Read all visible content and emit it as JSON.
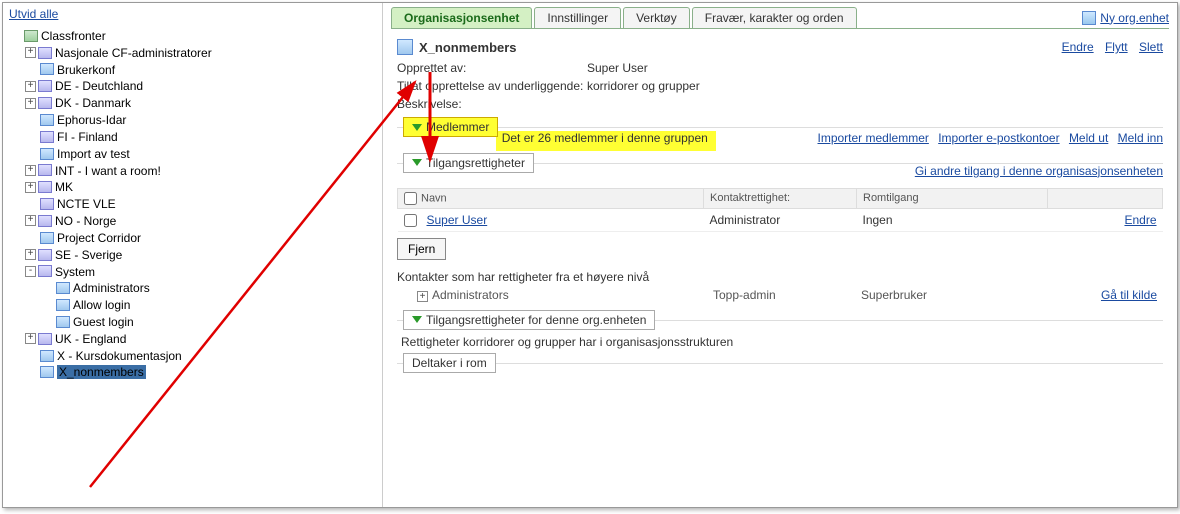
{
  "sidebar": {
    "expand_all": "Utvid alle",
    "items": [
      {
        "indent": 1,
        "toggle": "",
        "icon": "folder",
        "label": "Classfronter"
      },
      {
        "indent": 2,
        "toggle": "+",
        "icon": "grp",
        "label": "Nasjonale CF-administratorer"
      },
      {
        "indent": 2,
        "toggle": "",
        "icon": "usr",
        "label": "Brukerkonf"
      },
      {
        "indent": 2,
        "toggle": "+",
        "icon": "grp",
        "label": "DE - Deutchland"
      },
      {
        "indent": 2,
        "toggle": "+",
        "icon": "grp",
        "label": "DK - Danmark"
      },
      {
        "indent": 2,
        "toggle": "",
        "icon": "usr",
        "label": "Ephorus-Idar"
      },
      {
        "indent": 2,
        "toggle": "",
        "icon": "grp",
        "label": "FI - Finland"
      },
      {
        "indent": 2,
        "toggle": "",
        "icon": "usr",
        "label": "Import av test"
      },
      {
        "indent": 2,
        "toggle": "+",
        "icon": "grp",
        "label": "INT - I want a room!"
      },
      {
        "indent": 2,
        "toggle": "+",
        "icon": "grp",
        "label": "MK"
      },
      {
        "indent": 2,
        "toggle": "",
        "icon": "grp",
        "label": "NCTE VLE"
      },
      {
        "indent": 2,
        "toggle": "+",
        "icon": "grp",
        "label": "NO - Norge"
      },
      {
        "indent": 2,
        "toggle": "",
        "icon": "usr",
        "label": "Project Corridor"
      },
      {
        "indent": 2,
        "toggle": "+",
        "icon": "grp",
        "label": "SE - Sverige"
      },
      {
        "indent": 2,
        "toggle": "-",
        "icon": "grp",
        "label": "System"
      },
      {
        "indent": 3,
        "toggle": "",
        "icon": "usr",
        "label": "Administrators"
      },
      {
        "indent": 3,
        "toggle": "",
        "icon": "usr",
        "label": "Allow login"
      },
      {
        "indent": 3,
        "toggle": "",
        "icon": "usr",
        "label": "Guest login"
      },
      {
        "indent": 2,
        "toggle": "+",
        "icon": "grp",
        "label": "UK - England"
      },
      {
        "indent": 2,
        "toggle": "",
        "icon": "usr",
        "label": "X - Kursdokumentasjon"
      },
      {
        "indent": 2,
        "toggle": "",
        "icon": "usr",
        "label": "X_nonmembers",
        "selected": true
      }
    ]
  },
  "tabs": {
    "items": [
      {
        "label": "Organisasjonsenhet",
        "active": true
      },
      {
        "label": "Innstillinger"
      },
      {
        "label": "Verktøy"
      },
      {
        "label": "Fravær, karakter og orden"
      }
    ],
    "new_org": "Ny org.enhet"
  },
  "header": {
    "title": "X_nonmembers",
    "actions": {
      "edit": "Endre",
      "move": "Flytt",
      "delete": "Slett"
    },
    "created_by_label": "Opprettet av:",
    "created_by_value": "Super User",
    "allow_create_label": "Tillat opprettelse av underliggende:",
    "allow_create_value": "korridorer og grupper",
    "description_label": "Beskrivelse:"
  },
  "members": {
    "heading": "Medlemmer",
    "summary": "Det er 26 medlemmer i denne gruppen",
    "links": {
      "import_members": "Importer medlemmer",
      "import_email": "Importer e-postkontoer",
      "signout": "Meld ut",
      "signin": "Meld inn"
    }
  },
  "access": {
    "heading": "Tilgangsrettigheter",
    "grant_link": "Gi andre tilgang i denne organisasjonsenheten",
    "cols": {
      "name": "Navn",
      "contact": "Kontaktrettighet:",
      "room": "Romtilgang",
      "blank": ""
    },
    "rows": [
      {
        "name": "Super User",
        "contact": "Administrator",
        "room": "Ingen",
        "action": "Endre"
      }
    ],
    "remove_btn": "Fjern",
    "higher_label": "Kontakter som har rettigheter fra et høyere nivå",
    "higher_rows": [
      {
        "name": "Administrators",
        "role": "Topp-admin",
        "level": "Superbruker",
        "action": "Gå til kilde"
      }
    ]
  },
  "unit_access": {
    "heading": "Tilgangsrettigheter for denne org.enheten",
    "desc": "Rettigheter korridorer og grupper har i organisasjonsstrukturen"
  },
  "participants": {
    "heading": "Deltaker i rom"
  }
}
